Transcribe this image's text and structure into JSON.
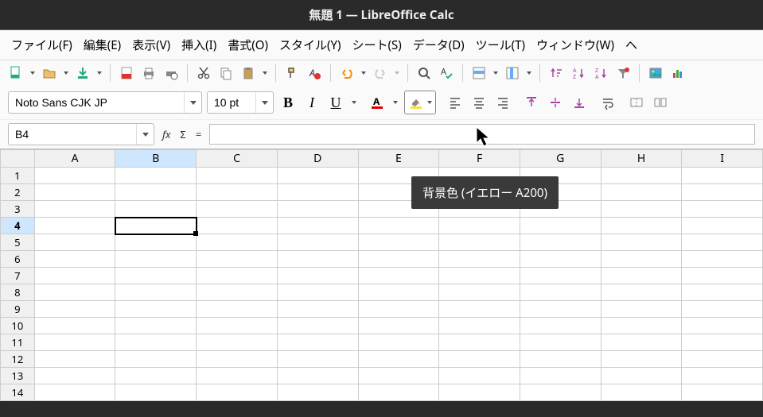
{
  "title": "無題 1 — LibreOffice Calc",
  "menu": [
    "ファイル(F)",
    "編集(E)",
    "表示(V)",
    "挿入(I)",
    "書式(O)",
    "スタイル(Y)",
    "シート(S)",
    "データ(D)",
    "ツール(T)",
    "ウィンドウ(W)",
    "ヘ"
  ],
  "font_name": "Noto Sans CJK JP",
  "font_size": "10 pt",
  "cell_ref": "B4",
  "formula_value": "",
  "tooltip": "背景色 (イエロー A200)",
  "columns": [
    "A",
    "B",
    "C",
    "D",
    "E",
    "F",
    "G",
    "H",
    "I"
  ],
  "rows": [
    "1",
    "2",
    "3",
    "4",
    "5",
    "6",
    "7",
    "8",
    "9",
    "10",
    "11",
    "12",
    "13",
    "14"
  ],
  "active_col": "B",
  "active_row": "4",
  "fmt": {
    "bold": "B",
    "italic": "I",
    "underline": "U"
  },
  "fx": {
    "fx": "fx",
    "sigma": "Σ",
    "eq": "="
  }
}
